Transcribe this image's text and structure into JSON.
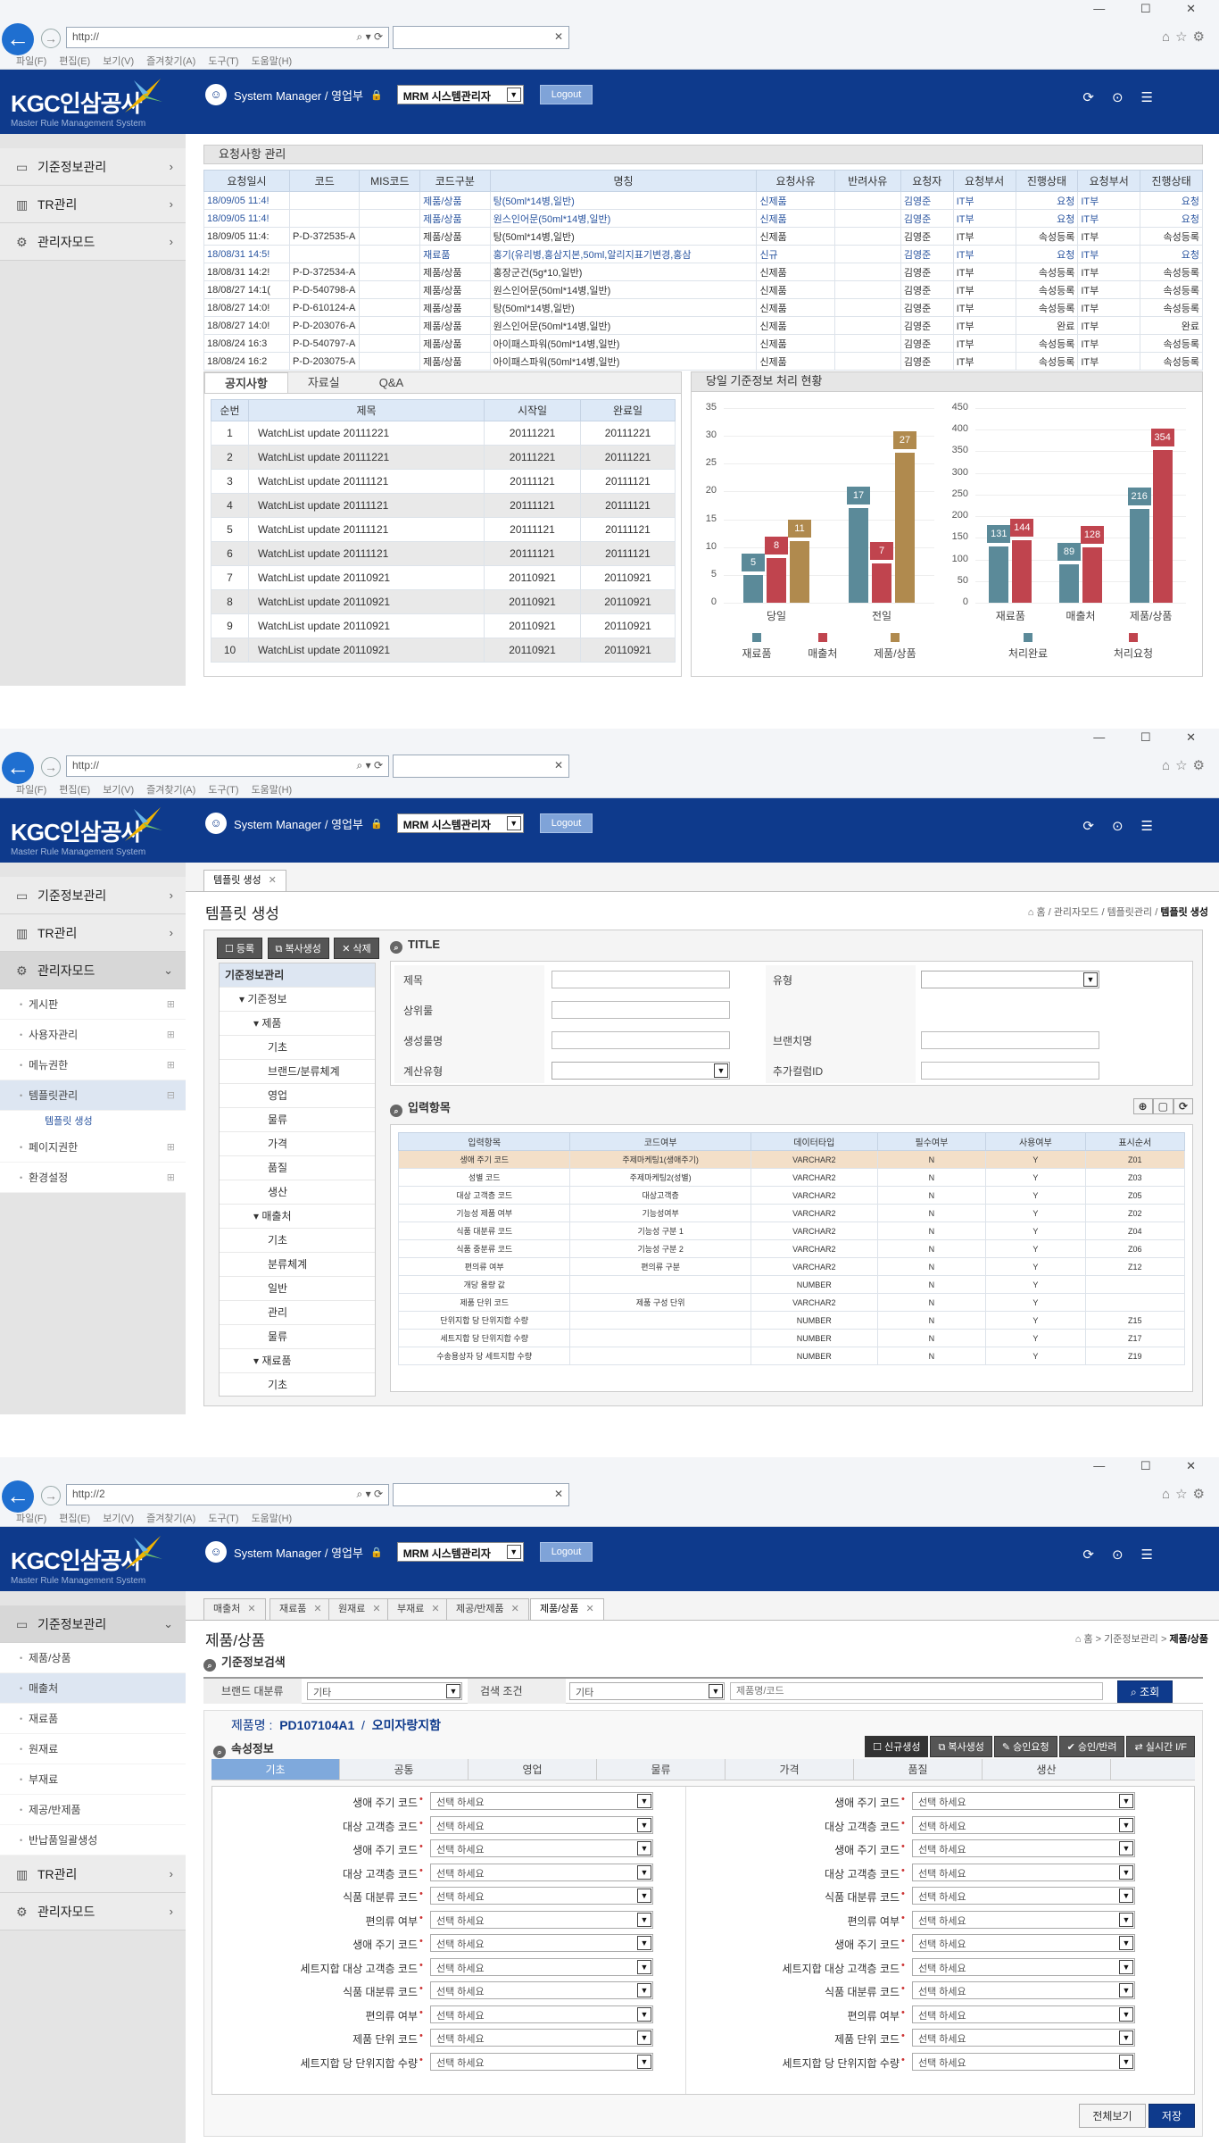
{
  "browser": {
    "url": "http://",
    "url3": "http://2",
    "menu": [
      "파일(F)",
      "편집(E)",
      "보기(V)",
      "즐겨찾기(A)",
      "도구(T)",
      "도움말(H)"
    ]
  },
  "header": {
    "brand": "KGC인삼공사",
    "brand_sub": "Master Rule Management System",
    "user": "System Manager / 영업부",
    "role": "MRM 시스템관리자",
    "logout": "Logout"
  },
  "s1": {
    "sidebar": [
      {
        "label": "기준정보관리"
      },
      {
        "label": "TR관리"
      },
      {
        "label": "관리자모드"
      }
    ],
    "req_title": "요청사항 관리",
    "req_cols": [
      "요청일시",
      "코드",
      "MIS코드",
      "코드구분",
      "명칭",
      "요청사유",
      "반려사유",
      "요청자",
      "요청부서",
      "진행상태",
      "요청부서",
      "진행상태"
    ],
    "req_rows": [
      [
        "18/09/05 11:4!",
        "",
        "",
        "제품/상품",
        "탕(50ml*14병,일반)",
        "신제품",
        "",
        "김영준",
        "IT부",
        "요청",
        "IT부",
        "요청"
      ],
      [
        "18/09/05 11:4!",
        "",
        "",
        "제품/상품",
        "원스인어문(50ml*14병,일반)",
        "신제품",
        "",
        "김영준",
        "IT부",
        "요청",
        "IT부",
        "요청"
      ],
      [
        "18/09/05 11:4:",
        "P-D-372535-A",
        "",
        "제품/상품",
        "탕(50ml*14병,일반)",
        "신제품",
        "",
        "김영준",
        "IT부",
        "속성등록",
        "IT부",
        "속성등록"
      ],
      [
        "18/08/31 14:5!",
        "",
        "",
        "재료품",
        "홍기(유리병,홍삼지본,50ml,알리지표기변경,홍삼",
        "신규",
        "",
        "김영준",
        "IT부",
        "요청",
        "IT부",
        "요청"
      ],
      [
        "18/08/31 14:2!",
        "P-D-372534-A",
        "",
        "제품/상품",
        "홍장군건(5g*10,일반)",
        "신제품",
        "",
        "김영준",
        "IT부",
        "속성등록",
        "IT부",
        "속성등록"
      ],
      [
        "18/08/27 14:1(",
        "P-D-540798-A",
        "",
        "제품/상품",
        "원스인어문(50ml*14병,일반)",
        "신제품",
        "",
        "김영준",
        "IT부",
        "속성등록",
        "IT부",
        "속성등록"
      ],
      [
        "18/08/27 14:0!",
        "P-D-610124-A",
        "",
        "제품/상품",
        "탕(50ml*14병,일반)",
        "신제품",
        "",
        "김영준",
        "IT부",
        "속성등록",
        "IT부",
        "속성등록"
      ],
      [
        "18/08/27 14:0!",
        "P-D-203076-A",
        "",
        "제품/상품",
        "원스인어문(50ml*14병,일반)",
        "신제품",
        "",
        "김영준",
        "IT부",
        "완료",
        "IT부",
        "완료"
      ],
      [
        "18/08/24 16:3",
        "P-D-540797-A",
        "",
        "제품/상품",
        "아이패스파워(50ml*14병,일반)",
        "신제품",
        "",
        "김영준",
        "IT부",
        "속성등록",
        "IT부",
        "속성등록"
      ],
      [
        "18/08/24 16:2",
        "P-D-203075-A",
        "",
        "제품/상품",
        "아이패스파워(50ml*14병,일반)",
        "신제품",
        "",
        "김영준",
        "IT부",
        "속성등록",
        "IT부",
        "속성등록"
      ]
    ],
    "notice_tabs": [
      "공지사항",
      "자료실",
      "Q&A"
    ],
    "notice_cols": [
      "순번",
      "제목",
      "시작일",
      "완료일"
    ],
    "notice_rows": [
      [
        "1",
        "WatchList update 20111221",
        "20111221",
        "20111221"
      ],
      [
        "2",
        "WatchList update 20111221",
        "20111221",
        "20111221"
      ],
      [
        "3",
        "WatchList update 20111121",
        "20111121",
        "20111121"
      ],
      [
        "4",
        "WatchList update 20111121",
        "20111121",
        "20111121"
      ],
      [
        "5",
        "WatchList update 20111121",
        "20111121",
        "20111121"
      ],
      [
        "6",
        "WatchList update 20111121",
        "20111121",
        "20111121"
      ],
      [
        "7",
        "WatchList update 20110921",
        "20110921",
        "20110921"
      ],
      [
        "8",
        "WatchList update 20110921",
        "20110921",
        "20110921"
      ],
      [
        "9",
        "WatchList update 20110921",
        "20110921",
        "20110921"
      ],
      [
        "10",
        "WatchList update 20110921",
        "20110921",
        "20110921"
      ]
    ],
    "chart_title": "당일 기준정보 처리 현황"
  },
  "chart_data": [
    {
      "type": "bar",
      "categories": [
        "당일",
        "전일"
      ],
      "series": [
        {
          "name": "재료품",
          "values": [
            5,
            17
          ],
          "color": "#5b8a99"
        },
        {
          "name": "매출처",
          "values": [
            8,
            7
          ],
          "color": "#c0444e"
        },
        {
          "name": "제품/상품",
          "values": [
            11,
            27
          ],
          "color": "#b08a4e"
        }
      ],
      "ylim": [
        0,
        35
      ],
      "yticks": [
        0,
        5,
        10,
        15,
        20,
        25,
        30,
        35
      ]
    },
    {
      "type": "bar",
      "categories": [
        "재료품",
        "매출처",
        "제품/상품"
      ],
      "series": [
        {
          "name": "처리완료",
          "values": [
            131,
            89,
            216
          ],
          "color": "#5b8a99"
        },
        {
          "name": "처리요청",
          "values": [
            144,
            128,
            354
          ],
          "color": "#c0444e"
        }
      ],
      "ylim": [
        0,
        450
      ],
      "yticks": [
        0,
        50,
        100,
        150,
        200,
        250,
        300,
        350,
        400,
        450
      ]
    }
  ],
  "s2": {
    "doc_tab": "템플릿 생성",
    "title": "템플릿 생성",
    "crumb": [
      "홈",
      "관리자모드",
      "템플릿관리",
      "템플릿 생성"
    ],
    "sidebar": {
      "top": [
        "기준정보관리",
        "TR관리",
        "관리자모드"
      ],
      "sub": [
        "게시판",
        "사용자관리",
        "메뉴권한",
        "템플릿관리",
        "페이지권한",
        "환경설정"
      ],
      "subsub": "템플릿 생성"
    },
    "buttons": [
      "등록",
      "복사생성",
      "삭제"
    ],
    "tree": [
      "기준정보관리",
      "기준정보",
      "제품",
      "기초",
      "브랜드/분류체계",
      "영업",
      "물류",
      "가격",
      "품질",
      "생산",
      "매출처",
      "기초",
      "분류체계",
      "일반",
      "관리",
      "물류",
      "재료품",
      "기초"
    ],
    "tree_level": [
      0,
      1,
      2,
      3,
      3,
      3,
      3,
      3,
      3,
      3,
      2,
      3,
      3,
      3,
      3,
      3,
      2,
      3
    ],
    "form_title": "TITLE",
    "form": {
      "제목": "제목",
      "유형": "유형",
      "상위룰": "상위룰",
      "생성룰명": "생성룰명",
      "브랜치명": "브랜치명",
      "계산유형": "계산유형",
      "추가컬럼ID": "추가컬럼ID"
    },
    "input_title": "입력항목",
    "cols": [
      "입력항목",
      "코드여부",
      "데이터타입",
      "필수여부",
      "사용여부",
      "표시순서"
    ],
    "rows": [
      [
        "생애 주기 코드",
        "주제마케팅1(생애주기)",
        "VARCHAR2",
        "N",
        "Y",
        "Z01"
      ],
      [
        "성별 코드",
        "주제마케팅2(성별)",
        "VARCHAR2",
        "N",
        "Y",
        "Z03"
      ],
      [
        "대상 고객층 코드",
        "대상고객층",
        "VARCHAR2",
        "N",
        "Y",
        "Z05"
      ],
      [
        "기능성 제품 여부",
        "기능성여부",
        "VARCHAR2",
        "N",
        "Y",
        "Z02"
      ],
      [
        "식품 대분류 코드",
        "기능성 구분 1",
        "VARCHAR2",
        "N",
        "Y",
        "Z04"
      ],
      [
        "식품 중분류 코드",
        "기능성 구분 2",
        "VARCHAR2",
        "N",
        "Y",
        "Z06"
      ],
      [
        "편의류 여부",
        "편의류 구분",
        "VARCHAR2",
        "N",
        "Y",
        "Z12"
      ],
      [
        "개당 용량 값",
        "",
        "NUMBER",
        "N",
        "Y",
        ""
      ],
      [
        "제품 단위 코드",
        "제품 구성 단위",
        "VARCHAR2",
        "N",
        "Y",
        ""
      ],
      [
        "단위지합 당 단위지합 수량",
        "",
        "NUMBER",
        "N",
        "Y",
        "Z15"
      ],
      [
        "세트지합 당 단위지합 수량",
        "",
        "NUMBER",
        "N",
        "Y",
        "Z17"
      ],
      [
        "수송용상자 당 세트지합 수량",
        "",
        "NUMBER",
        "N",
        "Y",
        "Z19"
      ]
    ]
  },
  "s3": {
    "tabs": [
      "매출처",
      "재료품",
      "원재료",
      "부재료",
      "제공/반제품",
      "제품/상품"
    ],
    "title": "제품/상품",
    "crumb": [
      "홈",
      "기준정보관리",
      "제품/상품"
    ],
    "sidebar": {
      "top": "기준정보관리",
      "sub": [
        "제품/상품",
        "매출처",
        "재료품",
        "원재료",
        "부재료",
        "제공/반제품",
        "반납품일괄생성"
      ],
      "bottom": [
        "TR관리",
        "관리자모드"
      ]
    },
    "search_title": "기준정보검색",
    "brand_label": "브랜드 대분류",
    "brand_value": "기타",
    "cond_label": "검색 조건",
    "cond_value": "기타",
    "search_placeholder": "제품명/코드",
    "search_btn": "조회",
    "product_label": "제품명 :",
    "product_code": "PD107104A1",
    "product_name": "오미자랑지함",
    "attr_title": "속성정보",
    "action_btns": [
      "신규생성",
      "복사생성",
      "승인요청",
      "승인/반려",
      "실시간 I/F"
    ],
    "attr_tabs": [
      "기초",
      "공통",
      "영업",
      "물류",
      "가격",
      "품질",
      "생산"
    ],
    "fields": [
      "생애 주기 코드",
      "대상 고객층 코드",
      "생애 주기 코드",
      "대상 고객층 코드",
      "식품 대분류 코드",
      "편의류 여부",
      "생애 주기 코드",
      "세트지합 대상 고객층 코드",
      "식품 대분류 코드",
      "편의류 여부",
      "제품 단위 코드",
      "세트지합 당 단위지합 수량"
    ],
    "select_value": "선택 하세요",
    "bottom_btns": [
      "전체보기",
      "저장"
    ]
  }
}
